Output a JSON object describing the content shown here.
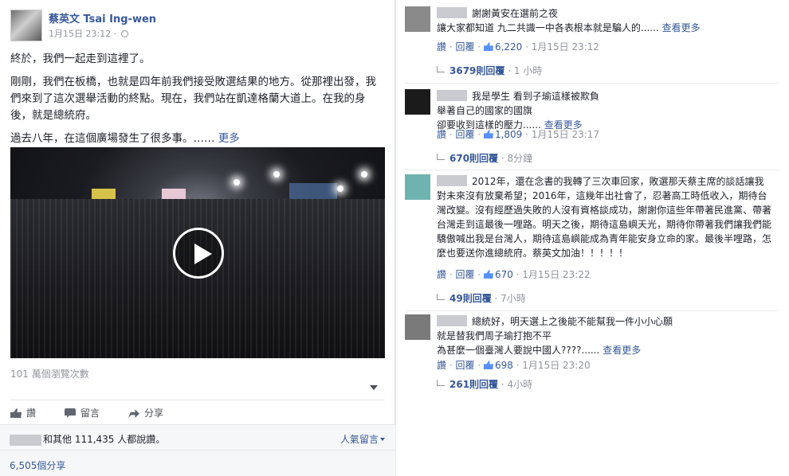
{
  "post": {
    "page_name": "蔡英文 Tsai Ing-wen",
    "timestamp": "1月15日 23:12",
    "separator": "·",
    "globe_icon": "globe-icon",
    "paragraphs": [
      "終於，我們一起走到這裡了。",
      "剛剛，我們在板橋，也就是四年前我們接受敗選結果的地方。從那裡出發，我們來到了這次選舉活動的終點。現在，我們站在凱達格蘭大道上。在我的身後，就是總統府。",
      "過去八年，在這個廣場發生了很多事。……"
    ],
    "more_label": "更多",
    "views": "101 萬個瀏覽次數",
    "actions": {
      "like": "讚",
      "comment": "留言",
      "share": "分享"
    },
    "likes_text": "和其他 111,435 人都說讚。",
    "sort_label": "人氣留言",
    "shares": "6,505個分享"
  },
  "comments": [
    {
      "lines": [
        "謝謝黃安在選前之夜",
        "讓大家都知道 九二共識一中各表根本就是騙人的......"
      ],
      "more": "查看更多",
      "like_label": "讚",
      "reply_label": "回覆",
      "likes": "6,220",
      "time": "1月15日 23:12",
      "replies": "3679則回覆",
      "reply_time": "1 小時",
      "avatar_color": "#8a8a8a"
    },
    {
      "lines": [
        "我是學生 看到子瑜這樣被欺負",
        "舉著自己的國家的國旗",
        "卻要收到這樣的壓力......"
      ],
      "more": "查看更多",
      "like_label": "讚",
      "reply_label": "回覆",
      "likes": "1,809",
      "time": "1月15日 23:17",
      "replies": "670則回覆",
      "reply_time": "8分鐘",
      "avatar_color": "#1b1b1b"
    },
    {
      "lines": [
        "2012年，還在念書的我轉了三次車回家，敗選那天蔡主席的談話讓我對未來沒有放棄希望；2016年，這幾年出社會了，忍著高工時低收入，期待台灣改變。沒有經歷過失敗的人沒有資格談成功，謝謝你這些年帶著民進黨、帶著台灣走到這最後一哩路。明天之後，期待這島嶼天光，期待你帶著我們讓我們能驕傲喊出我是台灣人，期待這島嶼能成為青年能安身立命的家。最後半哩路，怎麼也要送你進總統府。蔡英文加油！！！！！"
      ],
      "more": "",
      "like_label": "讚",
      "reply_label": "回覆",
      "likes": "670",
      "time": "1月15日 23:22",
      "replies": "49則回覆",
      "reply_time": "7小時",
      "avatar_color": "#6fb3b0"
    },
    {
      "lines": [
        "總統好，明天選上之後能不能幫我一件小小心願",
        "就是替我們周子瑜打抱不平",
        "為甚麼一個臺灣人要說中國人????......"
      ],
      "more": "查看更多",
      "like_label": "讚",
      "reply_label": "回覆",
      "likes": "698",
      "time": "1月15日 23:20",
      "replies": "261則回覆",
      "reply_time": "4小時",
      "avatar_color": "#7a7a7a"
    }
  ]
}
